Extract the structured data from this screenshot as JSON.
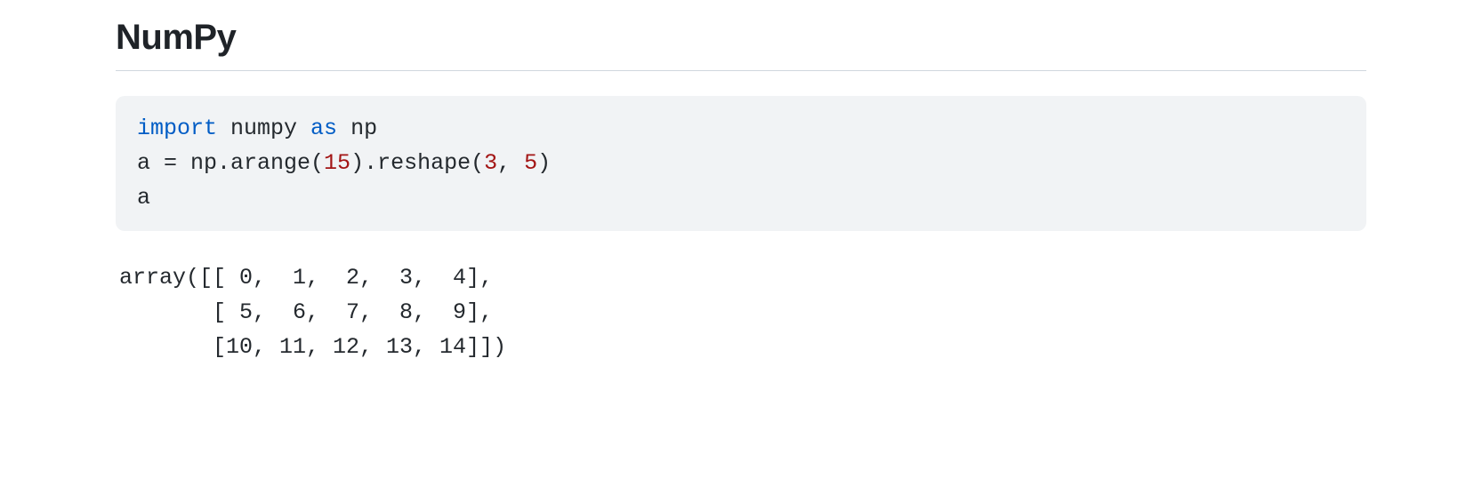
{
  "heading": "NumPy",
  "code": {
    "line1_kw1": "import",
    "line1_mid": " numpy ",
    "line1_kw2": "as",
    "line1_end": " np",
    "line2_pre": "a = np.arange(",
    "line2_num1": "15",
    "line2_mid": ").reshape(",
    "line2_num2": "3",
    "line2_sep": ", ",
    "line2_num3": "5",
    "line2_end": ")",
    "line3": "a"
  },
  "output": "array([[ 0,  1,  2,  3,  4],\n       [ 5,  6,  7,  8,  9],\n       [10, 11, 12, 13, 14]])"
}
